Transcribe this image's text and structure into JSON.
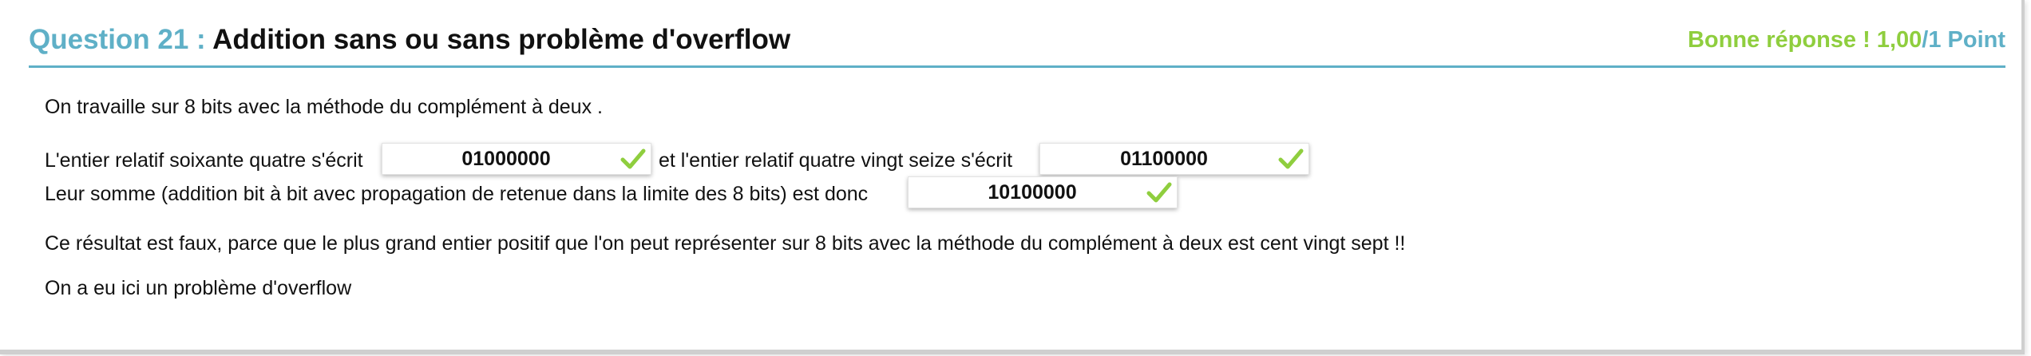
{
  "question": {
    "number_label": "Question 21 :",
    "title": "Addition sans ou sans problème d'overflow",
    "score_text": "Bonne réponse ! 1,00",
    "score_total": "/1 Point"
  },
  "body": {
    "intro": "On travaille sur 8 bits avec la méthode du complément à deux .",
    "line1_a": "L'entier relatif soixante quatre s'écrit",
    "answer1": "01000000",
    "line1_b": "et  l'entier relatif quatre vingt seize s'écrit",
    "answer2": "01100000",
    "line2_a": "Leur somme (addition bit à bit avec propagation de retenue dans la limite des 8 bits) est donc",
    "answer3": "10100000",
    "conclusion": "Ce résultat est faux, parce que le plus grand entier positif que l'on peut représenter sur 8 bits avec la méthode du complément à deux est cent vingt sept !!",
    "final": "On a eu ici un problème d'overflow"
  },
  "icons": {
    "correct": "checkmark-icon"
  },
  "colors": {
    "accent_blue": "#5fb0c7",
    "success_green": "#8fce3e"
  }
}
